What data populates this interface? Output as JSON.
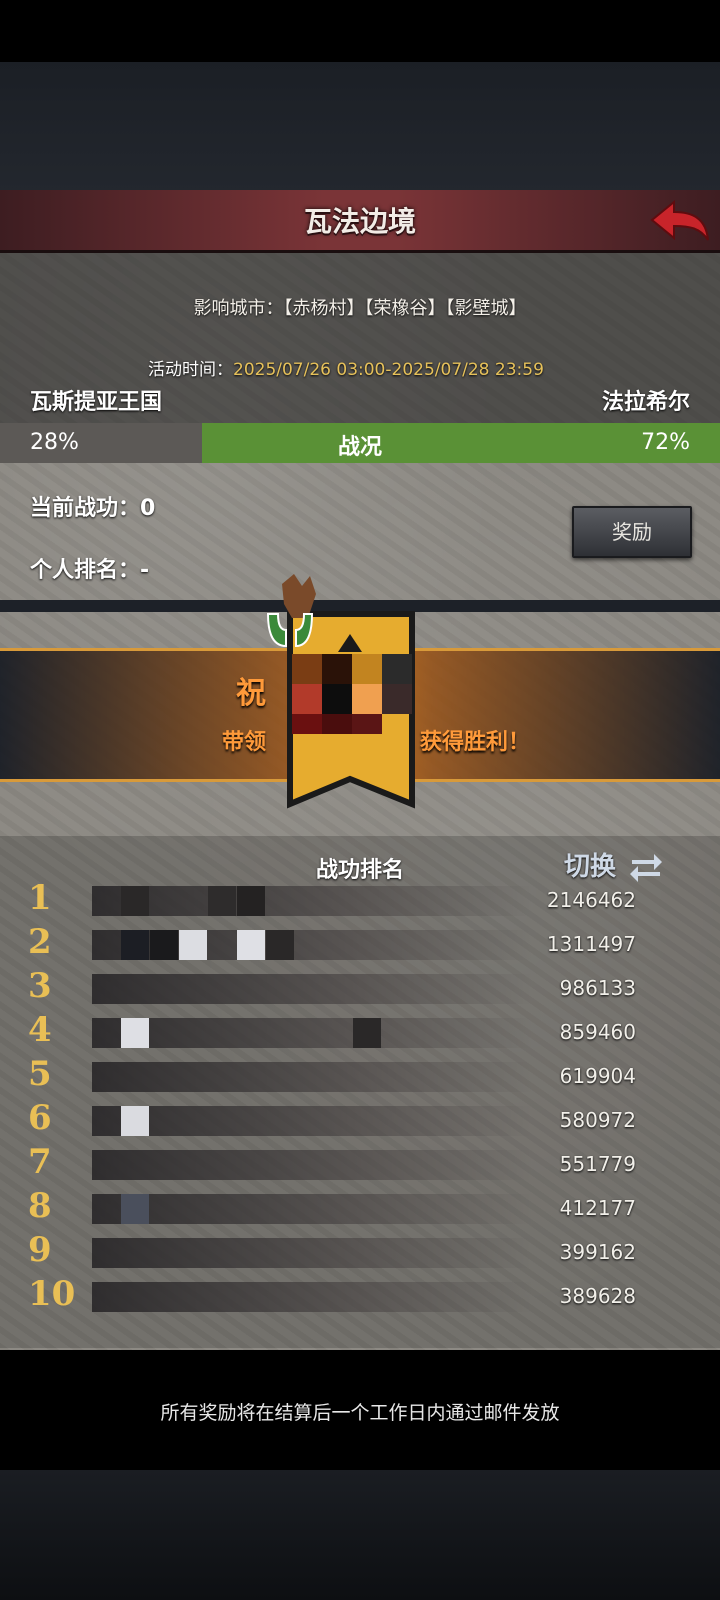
{
  "header": {
    "title": "瓦法边境"
  },
  "info": {
    "cities": "影响城市：【赤杨村】【荣橡谷】【影壁城】",
    "time_label": "活动时间：",
    "time_value": "2025/07/26 03:00-2025/07/28 23:59"
  },
  "battle": {
    "left_name": "瓦斯提亚王国",
    "right_name": "法拉希尔",
    "left_pct": "28%",
    "right_pct": "72%",
    "right_fraction": 0.72,
    "status_label": "战况",
    "left_color": "#5c5956",
    "right_color": "#5a9136"
  },
  "player": {
    "merit": "当前战功：0",
    "rank": "个人排名：-",
    "reward_button": "奖励"
  },
  "banner": {
    "congrats": "祝",
    "lead_text": "带领",
    "lead_tail": "获得胜利！"
  },
  "ranking": {
    "header": "战功排名",
    "switch_label": "切换",
    "rows": [
      {
        "rank": "1",
        "score": "2146462"
      },
      {
        "rank": "2",
        "score": "1311497"
      },
      {
        "rank": "3",
        "score": "986133"
      },
      {
        "rank": "4",
        "score": "859460"
      },
      {
        "rank": "5",
        "score": "619904"
      },
      {
        "rank": "6",
        "score": "580972"
      },
      {
        "rank": "7",
        "score": "551779"
      },
      {
        "rank": "8",
        "score": "412177"
      },
      {
        "rank": "9",
        "score": "399162"
      },
      {
        "rank": "10",
        "score": "389628"
      }
    ]
  },
  "footer": {
    "notice": "所有奖励将在结算后一个工作日内通过邮件发放"
  },
  "icons": {
    "back": "back-arrow-icon",
    "switch": "swap-arrows-icon",
    "emblem": "banner-emblem-icon"
  }
}
